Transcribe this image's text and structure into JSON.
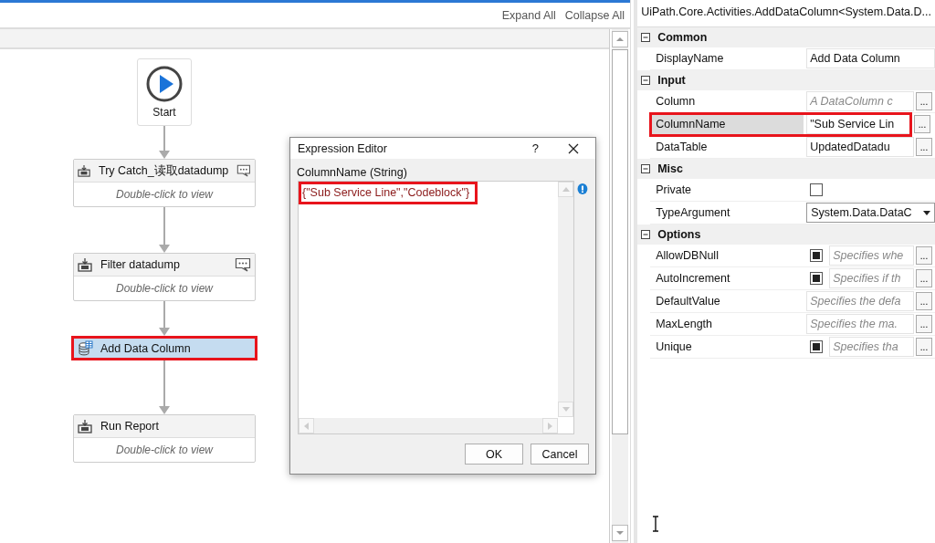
{
  "toolbar": {
    "links": [
      "Expand All",
      "Collapse All"
    ]
  },
  "flow": [
    {
      "kind": "start",
      "label": "Start"
    },
    {
      "kind": "container",
      "label": "Try Catch_读取datadump",
      "body": "Double-click to view",
      "comment": true
    },
    {
      "kind": "container",
      "label": "Filter datadump",
      "body": "Double-click to view",
      "comment": true
    },
    {
      "kind": "activity",
      "label": "Add Data Column",
      "selected": true,
      "highlighted": true
    },
    {
      "kind": "container",
      "label": "Run Report",
      "body": "Double-click to view",
      "comment": false
    }
  ],
  "dialog": {
    "title": "Expression Editor",
    "help": "?",
    "label": "ColumnName (String)",
    "value": "{\"Sub Service Line\",\"Codeblock\"}",
    "highlighted": true,
    "buttons": [
      "OK",
      "Cancel"
    ]
  },
  "properties": {
    "title": "UiPath.Core.Activities.AddDataColumn<System.Data.D...",
    "categories": [
      {
        "name": "Common",
        "expanded": true,
        "items": [
          {
            "name": "DisplayName",
            "kind": "text",
            "value": "Add Data Column",
            "selected": false,
            "highlighted": false
          }
        ]
      },
      {
        "name": "Input",
        "expanded": true,
        "items": [
          {
            "name": "Column",
            "kind": "text",
            "placeholder": "A DataColumn c",
            "selected": false,
            "highlighted": false,
            "more": "..."
          },
          {
            "name": "ColumnName",
            "kind": "text",
            "value": "\"Sub Service Lin",
            "selected": true,
            "highlighted": true,
            "more": "..."
          },
          {
            "name": "DataTable",
            "kind": "text",
            "value": "UpdatedDatadu",
            "selected": false,
            "highlighted": false,
            "more": "..."
          }
        ]
      },
      {
        "name": "Misc",
        "expanded": true,
        "items": [
          {
            "name": "Private",
            "kind": "checkbox",
            "checked": false,
            "selected": false,
            "highlighted": false
          },
          {
            "name": "TypeArgument",
            "kind": "dropdown",
            "value": "System.Data.DataC",
            "selected": false,
            "highlighted": false
          }
        ]
      },
      {
        "name": "Options",
        "expanded": true,
        "items": [
          {
            "name": "AllowDBNull",
            "kind": "checkbox_text",
            "checked": true,
            "placeholder": "Specifies whe",
            "selected": false,
            "highlighted": false,
            "more": "..."
          },
          {
            "name": "AutoIncrement",
            "kind": "checkbox_text",
            "checked": true,
            "placeholder": "Specifies if th",
            "selected": false,
            "highlighted": false,
            "more": "..."
          },
          {
            "name": "DefaultValue",
            "kind": "text",
            "placeholder": "Specifies the defa",
            "selected": false,
            "highlighted": false,
            "more": "..."
          },
          {
            "name": "MaxLength",
            "kind": "text",
            "placeholder": "Specifies the ma.",
            "selected": false,
            "highlighted": false,
            "more": "..."
          },
          {
            "name": "Unique",
            "kind": "checkbox_text",
            "checked": true,
            "placeholder": "Specifies tha",
            "selected": false,
            "highlighted": false,
            "more": "..."
          }
        ]
      }
    ]
  }
}
